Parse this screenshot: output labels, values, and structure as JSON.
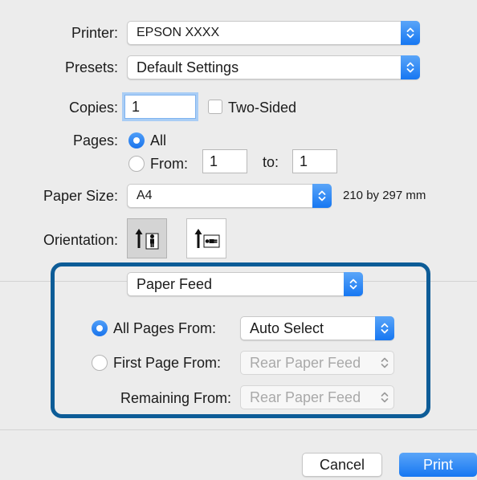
{
  "printer": {
    "label": "Printer:",
    "value": "EPSON XXXX"
  },
  "presets": {
    "label": "Presets:",
    "value": "Default Settings"
  },
  "copies": {
    "label": "Copies:",
    "value": "1",
    "two_sided_label": "Two-Sided",
    "two_sided_checked": false
  },
  "pages": {
    "label": "Pages:",
    "all_label": "All",
    "from_label": "From:",
    "from_value": "1",
    "to_label": "to:",
    "to_value": "1",
    "selected": "All"
  },
  "paper_size": {
    "label": "Paper Size:",
    "value": "A4",
    "dimensions": "210 by 297 mm"
  },
  "orientation": {
    "label": "Orientation:",
    "selected": "portrait"
  },
  "section": {
    "value": "Paper Feed"
  },
  "paper_feed": {
    "all_pages_label": "All Pages From:",
    "all_pages_value": "Auto Select",
    "first_page_label": "First Page From:",
    "first_page_value": "Rear Paper Feed",
    "remaining_label": "Remaining From:",
    "remaining_value": "Rear Paper Feed",
    "selected": "All Pages From"
  },
  "buttons": {
    "cancel": "Cancel",
    "print": "Print"
  },
  "colors": {
    "accent": "#1a74ec",
    "highlight_border": "#0d5c97",
    "background": "#ececec"
  }
}
